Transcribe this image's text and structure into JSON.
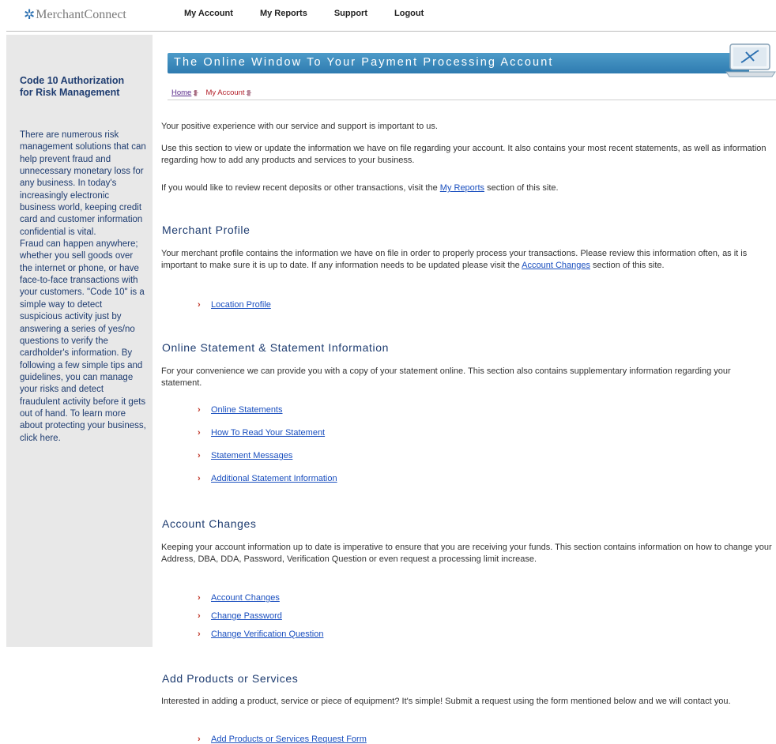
{
  "header": {
    "logo_text": "MerchantConnect",
    "nav": [
      "My Account",
      "My Reports",
      "Support",
      "Logout"
    ]
  },
  "sidebar": {
    "title": "Code 10 Authorization for Risk Management",
    "paragraph1": "There are numerous risk management solutions that can help prevent fraud and unnecessary monetary loss for any business. In today's increasingly electronic business world, keeping credit card and customer information confidential is vital.",
    "paragraph2": "Fraud can happen anywhere; whether you sell goods over the internet or phone, or have face-to-face transactions with your customers. \"Code 10\" is a simple way to detect suspicious activity just by answering a series of yes/no questions to verify the cardholder's information. By following a few simple tips and guidelines, you can manage your risks and detect fraudulent activity before it gets out of hand. To learn more about protecting your business, click here."
  },
  "banner": {
    "text": "The Online Window To Your Payment Processing Account"
  },
  "breadcrumb": {
    "home": "Home",
    "current": "My Account"
  },
  "intro": {
    "p1": "Your positive experience with our service and support is important to us.",
    "p2": "Use this section to view or update the information we have on file regarding your account. It also contains your most recent statements, as well as information regarding how to add any products and services to your business.",
    "p3_before": "If you would like to review recent deposits or other transactions, visit the ",
    "p3_link": "My Reports",
    "p3_after": " section of this site."
  },
  "sections": {
    "profile": {
      "heading": "Merchant Profile",
      "text_before": "Your merchant profile contains the information we have on file in order to properly process your transactions. Please review this information often, as it is important to make sure it is up to date. If any information needs to be updated please visit the ",
      "text_link": "Account Changes",
      "text_after": " section of this site.",
      "links": [
        "Location Profile"
      ]
    },
    "statement": {
      "heading": "Online Statement & Statement Information",
      "text": "For your convenience we can provide you with a copy of your statement online. This section also contains supplementary information regarding your statement.",
      "links": [
        "Online Statements",
        "How To Read Your Statement",
        "Statement Messages",
        "Additional Statement Information"
      ]
    },
    "changes": {
      "heading": "Account Changes",
      "text": "Keeping your account information up to date is imperative to ensure that you are receiving your funds. This section contains information on how to change your Address, DBA, DDA, Password, Verification Question or even request a processing limit increase.",
      "links": [
        "Account Changes",
        "Change Password",
        "Change Verification Question"
      ]
    },
    "products": {
      "heading": "Add Products or Services",
      "text": "Interested in adding a product, service or piece of equipment? It's simple! Submit a request using the form mentioned below and we will contact you.",
      "links": [
        "Add Products or Services Request Form"
      ]
    }
  }
}
